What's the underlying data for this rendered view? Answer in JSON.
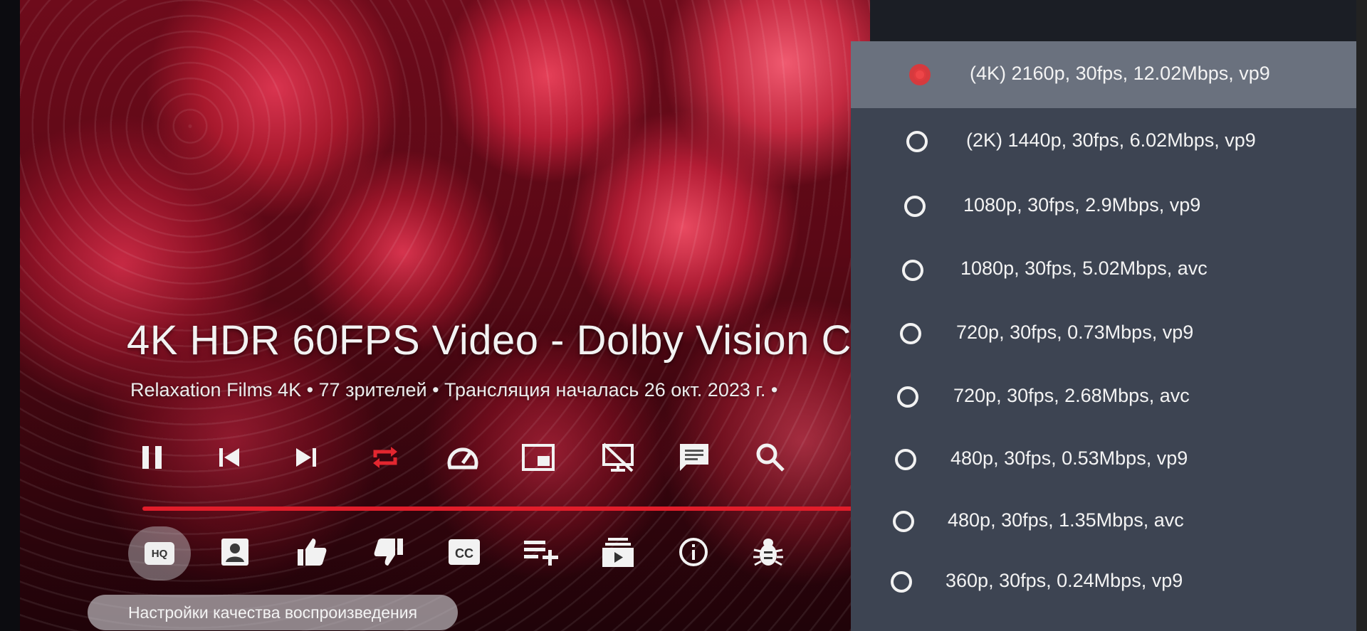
{
  "video": {
    "title": "4K HDR 60FPS Video - Dolby Vision C",
    "subtitle": "Relaxation Films 4K • 77 зрителей • Трансляция началась 26 окт. 2023 г. •",
    "progress_percent": 100
  },
  "colors": {
    "accent": "#e11d2a",
    "panel": "#3d4452",
    "selected_row": "#6a717e"
  },
  "controls": {
    "row1": [
      "pause-icon",
      "skip-previous-icon",
      "skip-next-icon",
      "repeat-icon",
      "speed-icon",
      "picture-in-picture-icon",
      "cast-off-icon",
      "chat-icon",
      "search-icon"
    ],
    "row2": [
      "hq-icon",
      "account-icon",
      "thumbs-up-icon",
      "thumbs-down-icon",
      "closed-captions-icon",
      "playlist-add-icon",
      "subscriptions-icon",
      "info-icon",
      "bug-icon"
    ],
    "hq_label": "HQ",
    "cc_label": "CC",
    "tooltip": "Настройки качества воспроизведения"
  },
  "quality": {
    "selected_index": 0,
    "options": [
      {
        "label": "(4K) 2160p, 30fps, 12.02Mbps, vp9"
      },
      {
        "label": "(2K) 1440p, 30fps, 6.02Mbps, vp9"
      },
      {
        "label": "1080p, 30fps, 2.9Mbps, vp9"
      },
      {
        "label": "1080p, 30fps, 5.02Mbps, avc"
      },
      {
        "label": "720p, 30fps, 0.73Mbps, vp9"
      },
      {
        "label": "720p, 30fps, 2.68Mbps, avc"
      },
      {
        "label": "480p, 30fps, 0.53Mbps, vp9"
      },
      {
        "label": "480p, 30fps, 1.35Mbps, avc"
      },
      {
        "label": "360p, 30fps, 0.24Mbps, vp9"
      }
    ]
  }
}
